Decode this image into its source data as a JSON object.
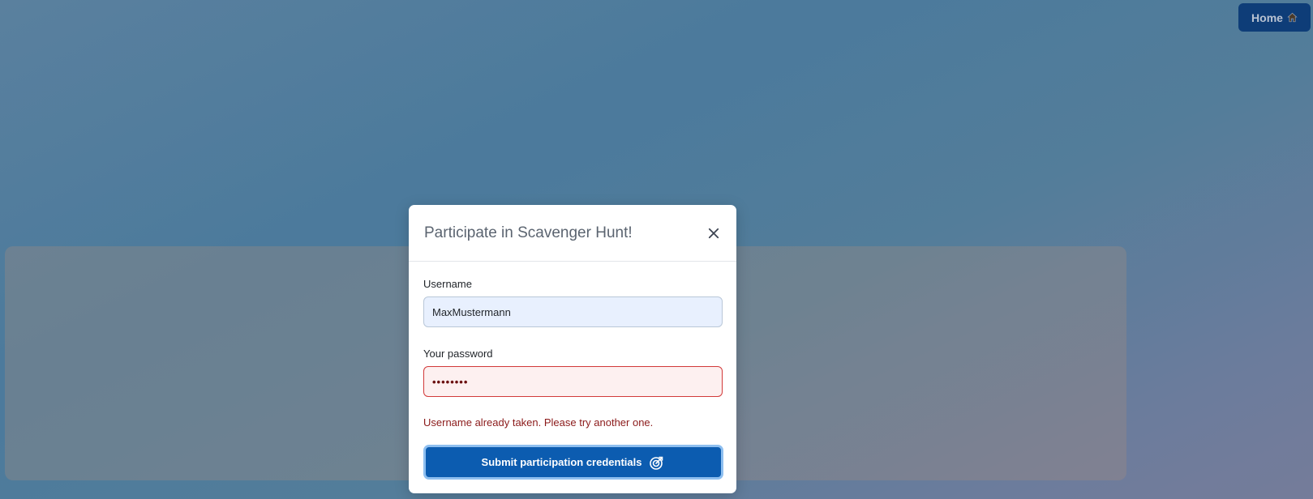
{
  "nav": {
    "home_label": "Home",
    "home_icon": "house-icon"
  },
  "modal": {
    "title": "Participate in Scavenger Hunt!",
    "close_icon": "close-icon",
    "username": {
      "label": "Username",
      "value": "MaxMustermann"
    },
    "password": {
      "label": "Your password",
      "masked_value": "••••••••"
    },
    "error_message": "Username already taken. Please try another one.",
    "submit": {
      "label": "Submit participation credentials",
      "icon": "target-arrow-icon"
    }
  },
  "colors": {
    "primary_button": "#0c5cb0",
    "home_button": "#0e3d78",
    "error": "#d23a3a",
    "error_text": "#8b1a1a"
  }
}
